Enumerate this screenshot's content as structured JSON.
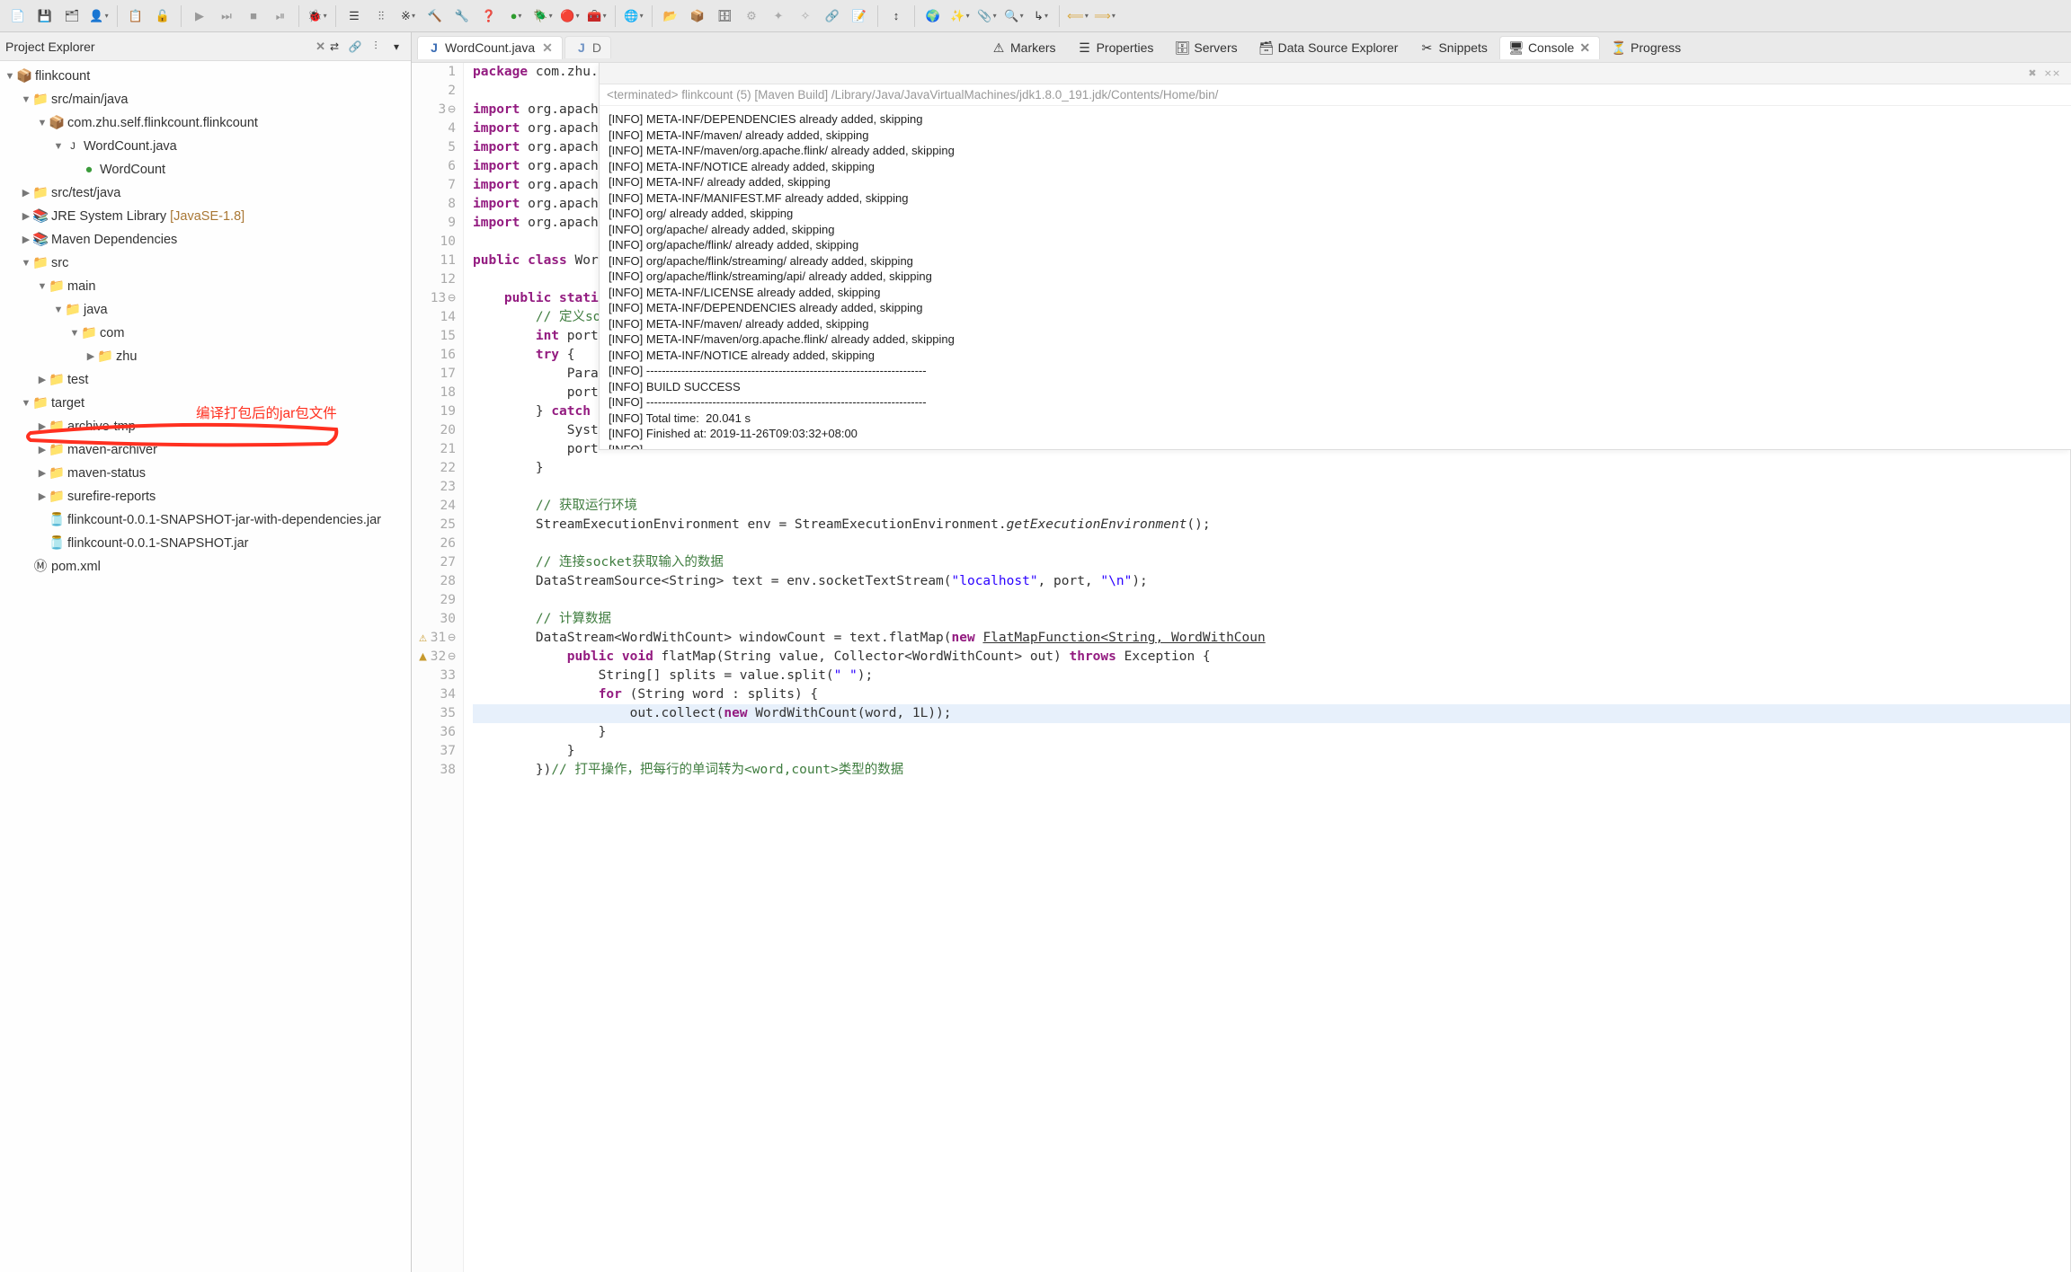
{
  "toolbar": {
    "icons": [
      "new-icon",
      "save-icon",
      "saveall-icon",
      "person-icon",
      "sep",
      "copy-icon",
      "open-icon",
      "debug-sep",
      "run-icon",
      "profile-icon",
      "sep2",
      "outline-icon",
      "outline2-icon",
      "filter-icon",
      "wand-icon",
      "search-icon",
      "config-icon",
      "run-green-icon",
      "dropdown-green-icon",
      "external-icon",
      "run-ext-icon",
      "run-ext2-icon",
      "globe-icon",
      "folder-out-icon",
      "package-icon",
      "wrench-icon",
      "git-icon",
      "wand2-icon",
      "wand3-icon",
      "play-icon",
      "doc-icon",
      "world-icon",
      "magic-icon",
      "clipboard-icon",
      "step-icon",
      "back-icon",
      "forward-icon"
    ]
  },
  "explorer": {
    "title": "Project Explorer",
    "project": "flinkcount",
    "nodes": [
      {
        "indent": 0,
        "arrow": "▼",
        "icon": "📦",
        "label": "flinkcount"
      },
      {
        "indent": 1,
        "arrow": "▼",
        "icon": "📁",
        "label": "src/main/java",
        "cls": "ico-pkg"
      },
      {
        "indent": 2,
        "arrow": "▼",
        "icon": "📦",
        "label": "com.zhu.self.flinkcount.flinkcount"
      },
      {
        "indent": 3,
        "arrow": "▼",
        "icon": "J",
        "label": "WordCount.java",
        "cls": "ico-java"
      },
      {
        "indent": 4,
        "arrow": "",
        "icon": "●",
        "label": "WordCount",
        "green": true
      },
      {
        "indent": 1,
        "arrow": "▶",
        "icon": "📁",
        "label": "src/test/java"
      },
      {
        "indent": 1,
        "arrow": "▶",
        "icon": "📚",
        "label": "JRE System Library",
        "suffix": " [JavaSE-1.8]"
      },
      {
        "indent": 1,
        "arrow": "▶",
        "icon": "📚",
        "label": "Maven Dependencies"
      },
      {
        "indent": 1,
        "arrow": "▼",
        "icon": "📁",
        "label": "src"
      },
      {
        "indent": 2,
        "arrow": "▼",
        "icon": "📁",
        "label": "main"
      },
      {
        "indent": 3,
        "arrow": "▼",
        "icon": "📁",
        "label": "java"
      },
      {
        "indent": 4,
        "arrow": "▼",
        "icon": "📁",
        "label": "com"
      },
      {
        "indent": 5,
        "arrow": "▶",
        "icon": "📁",
        "label": "zhu"
      },
      {
        "indent": 2,
        "arrow": "▶",
        "icon": "📁",
        "label": "test"
      },
      {
        "indent": 1,
        "arrow": "▼",
        "icon": "📁",
        "label": "target"
      },
      {
        "indent": 2,
        "arrow": "▶",
        "icon": "📁",
        "label": "archive-tmp"
      },
      {
        "indent": 2,
        "arrow": "▶",
        "icon": "📁",
        "label": "maven-archiver"
      },
      {
        "indent": 2,
        "arrow": "▶",
        "icon": "📁",
        "label": "maven-status"
      },
      {
        "indent": 2,
        "arrow": "▶",
        "icon": "📁",
        "label": "surefire-reports"
      },
      {
        "indent": 2,
        "arrow": "",
        "icon": "🫙",
        "label": "flinkcount-0.0.1-SNAPSHOT-jar-with-dependencies.jar"
      },
      {
        "indent": 2,
        "arrow": "",
        "icon": "🫙",
        "label": "flinkcount-0.0.1-SNAPSHOT.jar"
      },
      {
        "indent": 1,
        "arrow": "",
        "icon": "Ⓜ",
        "label": "pom.xml"
      }
    ],
    "annotation_text": "编译打包后的jar包文件"
  },
  "editor": {
    "tab_active": "WordCount.java",
    "tab_other": "D",
    "lines": [
      {
        "n": 1,
        "html": "<span class='kw'>package</span> com.zhu.s"
      },
      {
        "n": 2,
        "html": ""
      },
      {
        "n": 3,
        "mark": "⊖",
        "html": "<span class='kw'>import</span> org.apache"
      },
      {
        "n": 4,
        "html": "<span class='kw'>import</span> org.apache"
      },
      {
        "n": 5,
        "html": "<span class='kw'>import</span> org.apache"
      },
      {
        "n": 6,
        "html": "<span class='kw'>import</span> org.apache"
      },
      {
        "n": 7,
        "html": "<span class='kw'>import</span> org.apache"
      },
      {
        "n": 8,
        "html": "<span class='kw'>import</span> org.apache"
      },
      {
        "n": 9,
        "html": "<span class='kw'>import</span> org.apache"
      },
      {
        "n": 10,
        "html": ""
      },
      {
        "n": 11,
        "html": "<span class='kw'>public class</span> Word"
      },
      {
        "n": 12,
        "html": ""
      },
      {
        "n": 13,
        "mark": "⊖",
        "html": "    <span class='kw'>public static</span>"
      },
      {
        "n": 14,
        "html": "        <span class='cmt'>// 定义soc</span>"
      },
      {
        "n": 15,
        "html": "        <span class='kw'>int</span> port;"
      },
      {
        "n": 16,
        "html": "        <span class='kw'>try</span> {"
      },
      {
        "n": 17,
        "html": "            Param"
      },
      {
        "n": 18,
        "html": "            port "
      },
      {
        "n": 19,
        "html": "        } <span class='kw'>catch</span> ("
      },
      {
        "n": 20,
        "html": "            Syste"
      },
      {
        "n": 21,
        "html": "            port "
      },
      {
        "n": 22,
        "html": "        }"
      },
      {
        "n": 23,
        "html": ""
      },
      {
        "n": 24,
        "html": "        <span class='cmt'>// 获取运行环境</span>"
      },
      {
        "n": 25,
        "html": "        StreamExecutionEnvironment env = StreamExecutionEnvironment.<span class='call'>getExecutionEnvironment</span>();"
      },
      {
        "n": 26,
        "html": ""
      },
      {
        "n": 27,
        "html": "        <span class='cmt'>// 连接socket获取输入的数据</span>"
      },
      {
        "n": 28,
        "html": "        DataStreamSource&lt;String&gt; text = env.socketTextStream(<span class='str'>\"localhost\"</span>, port, <span class='str'>\"\\n\"</span>);"
      },
      {
        "n": 29,
        "html": ""
      },
      {
        "n": 30,
        "html": "        <span class='cmt'>// 计算数据</span>"
      },
      {
        "n": 31,
        "mark": "⊖",
        "gicon": "⚠",
        "html": "        DataStream&lt;WordWithCount&gt; windowCount = text.flatMap(<span class='kw'>new</span> <u>FlatMapFunction&lt;String, WordWithCoun</u>"
      },
      {
        "n": 32,
        "mark": "⊖",
        "gicon": "▲",
        "html": "            <span class='kw'>public void</span> flatMap(String value, Collector&lt;WordWithCount&gt; out) <span class='kw'>throws</span> Exception {"
      },
      {
        "n": 33,
        "html": "                String[] splits = value.split(<span class='str'>\" \"</span>);"
      },
      {
        "n": 34,
        "html": "                <span class='kw'>for</span> (String word : splits) {"
      },
      {
        "n": 35,
        "hl": true,
        "html": "                    out.collect(<span class='kw'>new</span> WordWithCount(word, 1L));"
      },
      {
        "n": 36,
        "html": "                }"
      },
      {
        "n": 37,
        "html": "            }"
      },
      {
        "n": 38,
        "html": "        })<span class='cmt'>// 打平操作，把每行的单词转为&lt;word,count&gt;类型的数据</span>"
      }
    ]
  },
  "views": {
    "tabs": [
      "Markers",
      "Properties",
      "Servers",
      "Data Source Explorer",
      "Snippets",
      "Console",
      "Progress"
    ],
    "active": 5
  },
  "console": {
    "header": "<terminated> flinkcount (5) [Maven Build] /Library/Java/JavaVirtualMachines/jdk1.8.0_191.jdk/Contents/Home/bin/",
    "lines": [
      "[INFO] META-INF/DEPENDENCIES already added, skipping",
      "[INFO] META-INF/maven/ already added, skipping",
      "[INFO] META-INF/maven/org.apache.flink/ already added, skipping",
      "[INFO] META-INF/NOTICE already added, skipping",
      "[INFO] META-INF/ already added, skipping",
      "[INFO] META-INF/MANIFEST.MF already added, skipping",
      "[INFO] org/ already added, skipping",
      "[INFO] org/apache/ already added, skipping",
      "[INFO] org/apache/flink/ already added, skipping",
      "[INFO] org/apache/flink/streaming/ already added, skipping",
      "[INFO] org/apache/flink/streaming/api/ already added, skipping",
      "[INFO] META-INF/LICENSE already added, skipping",
      "[INFO] META-INF/DEPENDENCIES already added, skipping",
      "[INFO] META-INF/maven/ already added, skipping",
      "[INFO] META-INF/maven/org.apache.flink/ already added, skipping",
      "[INFO] META-INF/NOTICE already added, skipping",
      "[INFO] ------------------------------------------------------------------------",
      "[INFO] BUILD SUCCESS",
      "[INFO] ------------------------------------------------------------------------",
      "[INFO] Total time:  20.041 s",
      "[INFO] Finished at: 2019-11-26T09:03:32+08:00",
      "[INFO] ------------------------------------------------------------------------"
    ]
  }
}
